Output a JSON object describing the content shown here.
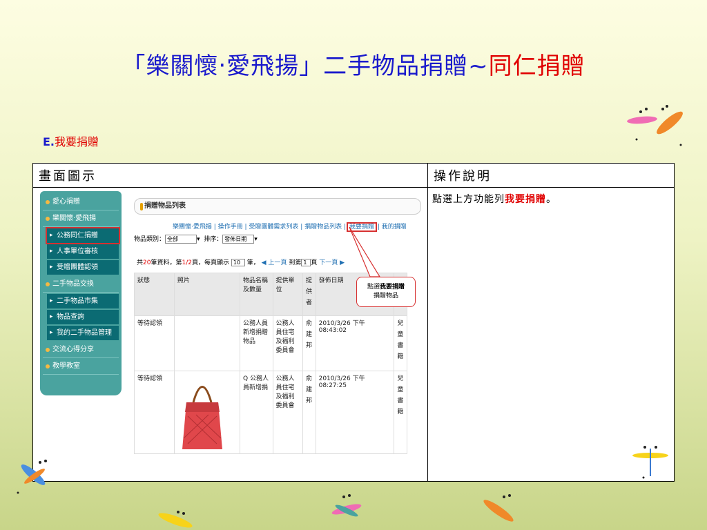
{
  "title": {
    "part1": "「樂關懷‧愛飛揚」二手物品捐贈~",
    "part2": "同仁捐贈"
  },
  "subtitle": {
    "prefix": "E.",
    "text": "我要捐贈"
  },
  "table": {
    "col1_header": "畫面圖示",
    "col2_header": "操作說明",
    "desc_before": "點選上方功能列",
    "desc_em": "我要捐贈",
    "desc_after": "。"
  },
  "sidebar": {
    "items": [
      {
        "label": "愛心捐贈",
        "type": "group"
      },
      {
        "label": "樂關懷‧愛飛揚",
        "type": "group"
      },
      {
        "label": "公務同仁捐贈",
        "type": "sub"
      },
      {
        "label": "人事單位審核",
        "type": "sub"
      },
      {
        "label": "受贈團體認領",
        "type": "sub"
      },
      {
        "label": "二手物品交換",
        "type": "group"
      },
      {
        "label": "二手物品市集",
        "type": "sub"
      },
      {
        "label": "物品查詢",
        "type": "sub"
      },
      {
        "label": "我的二手物品管理",
        "type": "sub"
      },
      {
        "label": "交流心得分享",
        "type": "group"
      },
      {
        "label": "教學教室",
        "type": "group"
      }
    ]
  },
  "content": {
    "header": "捐贈物品列表",
    "links": [
      "樂關懷‧愛飛揚",
      "操作手冊",
      "受贈團體需求列表",
      "捐贈物品列表",
      "我要捐贈",
      "我的捐贈"
    ],
    "filter": {
      "category_label": "物品類別：",
      "category_value": "全部",
      "sort_label": "排序：",
      "sort_value": "發佈日期"
    },
    "pager": {
      "p1": "共",
      "total": "20",
      "p2": "筆資料，第",
      "page": "1/2",
      "p3": "頁，每頁顯示",
      "per": "10",
      "p4": "筆，",
      "prev": "上一頁",
      "goto": "到第",
      "gopage": "1",
      "p5": "頁",
      "next": "下一頁"
    },
    "columns": [
      "狀態",
      "照片",
      "物品名稱及數量",
      "提供單位",
      "提供者",
      "發佈日期",
      ""
    ],
    "rows": [
      {
        "status": "等待認領",
        "name": "公務人員新增捐贈物品",
        "unit": "公務人員住宅及福利委員會",
        "provider": "俞建邦",
        "date": "2010/3/26 下午 08:43:02",
        "cat": "兒童書籍"
      },
      {
        "status": "等待認領",
        "name": "Q 公務人員新增捐",
        "unit": "公務人員住宅及福利委員會",
        "provider": "俞建邦",
        "date": "2010/3/26 下午 08:27:25",
        "cat": "兒童書籍"
      }
    ],
    "callout": {
      "line1a": "點選",
      "line1b": "我要捐贈",
      "line2": "捐贈物品"
    }
  },
  "colors": {
    "title_blue": "#1a1acc",
    "accent_red": "#e00000",
    "sidebar": "#4aa39f"
  }
}
